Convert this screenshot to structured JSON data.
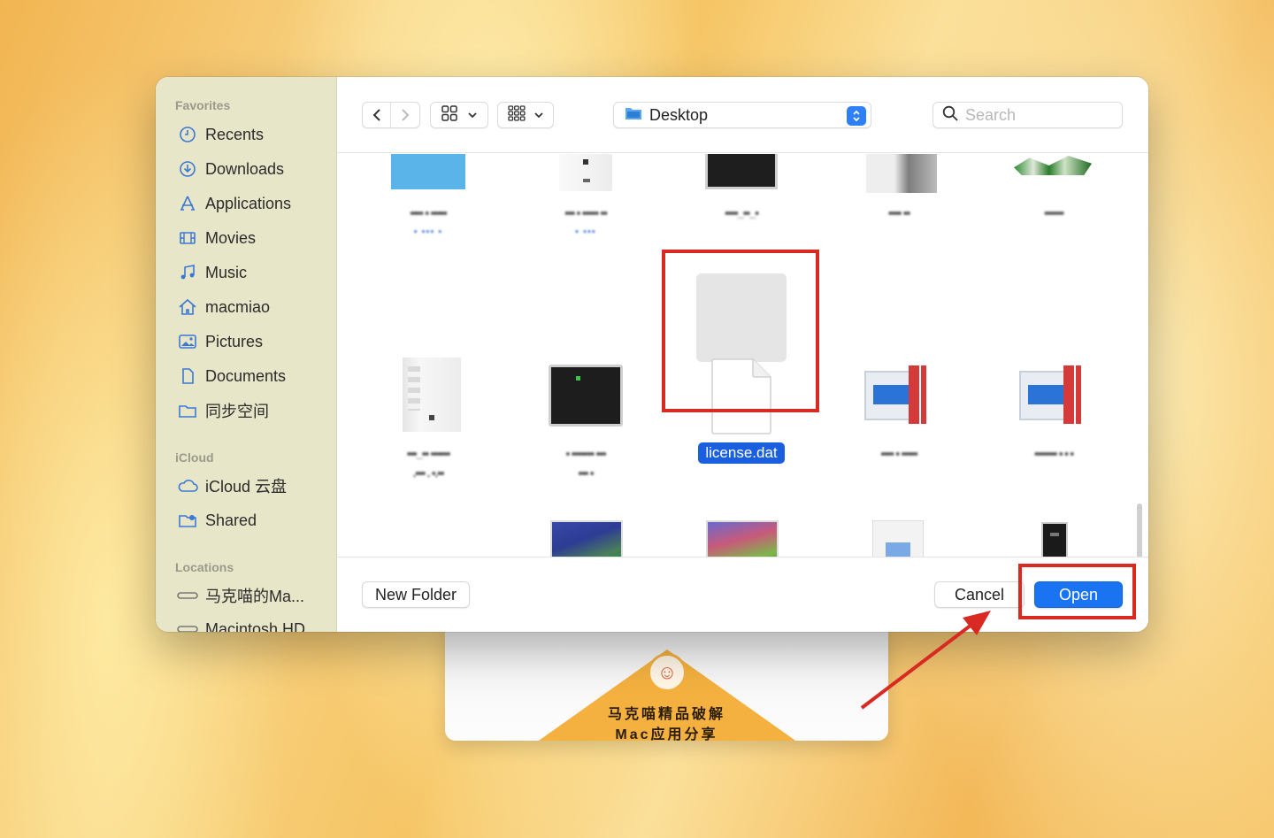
{
  "sidebar": {
    "favorites_title": "Favorites",
    "favorites": [
      {
        "label": "Recents",
        "icon": "clock-icon"
      },
      {
        "label": "Downloads",
        "icon": "download-icon"
      },
      {
        "label": "Applications",
        "icon": "applications-icon"
      },
      {
        "label": "Movies",
        "icon": "film-icon"
      },
      {
        "label": "Music",
        "icon": "music-note-icon"
      },
      {
        "label": "macmiao",
        "icon": "home-icon"
      },
      {
        "label": "Pictures",
        "icon": "photo-icon"
      },
      {
        "label": "Documents",
        "icon": "document-icon"
      },
      {
        "label": "同步空间",
        "icon": "folder-icon"
      }
    ],
    "icloud_title": "iCloud",
    "icloud": [
      {
        "label": "iCloud 云盘",
        "icon": "cloud-icon"
      },
      {
        "label": "Shared",
        "icon": "shared-folder-icon"
      }
    ],
    "locations_title": "Locations",
    "locations": [
      {
        "label": "马克喵的Ma...",
        "icon": "disk-icon"
      },
      {
        "label": "Macintosh HD",
        "icon": "disk-icon"
      }
    ]
  },
  "toolbar": {
    "current_folder": "Desktop",
    "search_placeholder": "Search"
  },
  "files": {
    "selected_name": "license.dat"
  },
  "bottom": {
    "new_folder": "New Folder",
    "cancel": "Cancel",
    "open": "Open"
  },
  "promo": {
    "line1": "马克喵精品破解",
    "line2": "Mac应用分享"
  },
  "colors": {
    "accent": "#1a74f2",
    "highlight": "#d82a23",
    "sidebar_bg": "#e8e6c9"
  }
}
